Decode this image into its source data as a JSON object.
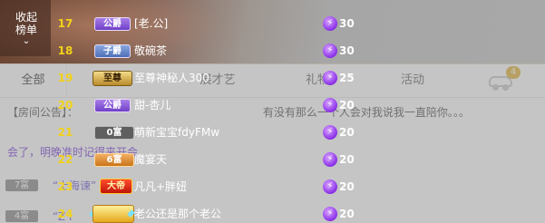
{
  "tabs": [
    {
      "label": "全部"
    },
    {
      "label": "展才艺"
    },
    {
      "label": "礼物"
    },
    {
      "label": "活动"
    },
    {
      "label": ""
    }
  ],
  "car_badge": "4",
  "help_glyph": "?",
  "announcement": {
    "label": "【房间公告】：",
    "text": "有没有那么一个人会对我说我一直陪你。。。"
  },
  "chat_message": "会了，明晚准时记得来开会",
  "chat_rows": [
    {
      "badge": "7富",
      "text": "“上海谏”"
    },
    {
      "badge": "4富",
      "text": "“Z I"
    }
  ],
  "ranking": {
    "collapse_label": "收起榜单",
    "rows": [
      {
        "rank": "17",
        "title": "公爵",
        "name": "[老.公]",
        "score": "30"
      },
      {
        "rank": "18",
        "title": "子爵",
        "name": "敬碗茶",
        "score": "30"
      },
      {
        "rank": "19",
        "title": "至尊",
        "name": "至尊神秘人300",
        "score": "25"
      },
      {
        "rank": "20",
        "title": "公爵",
        "name": "甜-杏儿",
        "score": "20"
      },
      {
        "rank": "21",
        "title": "0富",
        "name": "萌新宝宝fdyFMw",
        "score": "20"
      },
      {
        "rank": "22",
        "title": "6富",
        "name": "魔宴天",
        "score": "20"
      },
      {
        "rank": "23",
        "title": "大帝",
        "name": "凡凡+胖妞",
        "score": "20"
      },
      {
        "rank": "24",
        "title": "",
        "name": "老公还是那个老公",
        "score": "20"
      }
    ]
  },
  "colors": {
    "rank_number": "#f2d21a",
    "score_icon": "#8a2ee8",
    "chat_purple": "#7a3fd8"
  }
}
